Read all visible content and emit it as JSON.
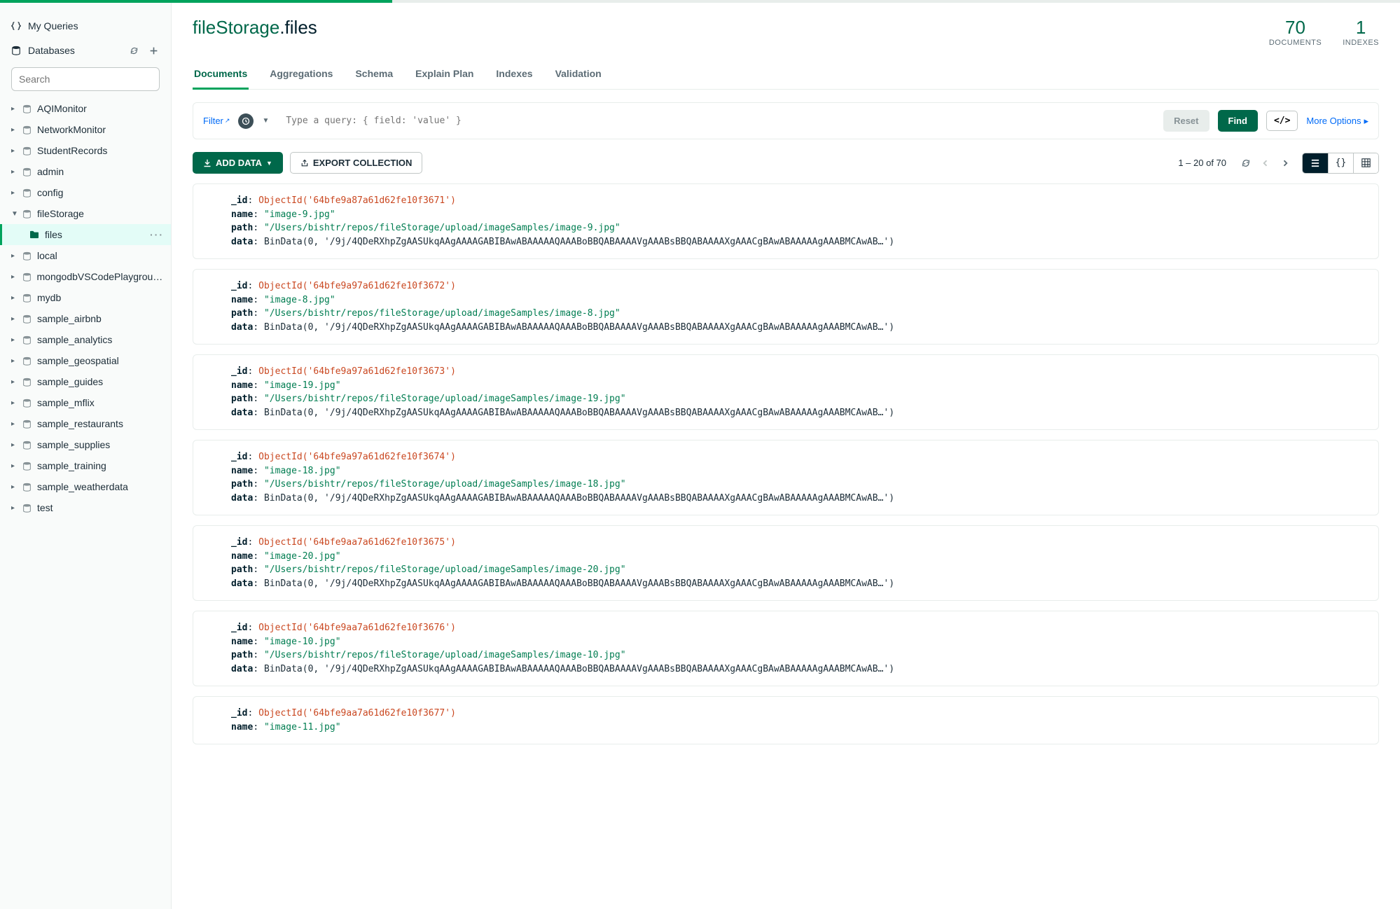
{
  "sidebar": {
    "my_queries": "My Queries",
    "databases_label": "Databases",
    "search_placeholder": "Search",
    "databases": [
      {
        "name": "AQIMonitor"
      },
      {
        "name": "NetworkMonitor"
      },
      {
        "name": "StudentRecords"
      },
      {
        "name": "admin"
      },
      {
        "name": "config"
      },
      {
        "name": "fileStorage",
        "expanded": true,
        "children": [
          {
            "name": "files",
            "selected": true
          }
        ]
      },
      {
        "name": "local"
      },
      {
        "name": "mongodbVSCodePlayground..."
      },
      {
        "name": "mydb"
      },
      {
        "name": "sample_airbnb"
      },
      {
        "name": "sample_analytics"
      },
      {
        "name": "sample_geospatial"
      },
      {
        "name": "sample_guides"
      },
      {
        "name": "sample_mflix"
      },
      {
        "name": "sample_restaurants"
      },
      {
        "name": "sample_supplies"
      },
      {
        "name": "sample_training"
      },
      {
        "name": "sample_weatherdata"
      },
      {
        "name": "test"
      }
    ]
  },
  "header": {
    "db_name": "fileStorage",
    "coll_name": ".files",
    "stats": [
      {
        "value": "70",
        "label": "DOCUMENTS"
      },
      {
        "value": "1",
        "label": "INDEXES"
      }
    ]
  },
  "tabs": [
    "Documents",
    "Aggregations",
    "Schema",
    "Explain Plan",
    "Indexes",
    "Validation"
  ],
  "filter": {
    "label": "Filter",
    "placeholder": "Type a query: { field: 'value' }",
    "reset": "Reset",
    "find": "Find",
    "code_toggle": "</>",
    "more_options": "More Options"
  },
  "toolbar": {
    "add_data": "ADD DATA",
    "export": "EXPORT COLLECTION",
    "page_info": "1 – 20 of 70",
    "json_view": "{}"
  },
  "documents": [
    {
      "id": "ObjectId('64bfe9a87a61d62fe10f3671')",
      "name": "\"image-9.jpg\"",
      "path": "\"/Users/bishtr/repos/fileStorage/upload/imageSamples/image-9.jpg\"",
      "data": "BinData(0, '/9j/4QDeRXhpZgAASUkqAAgAAAAGABIBAwABAAAAAQAAABoBBQABAAAAVgAAABsBBQABAAAAXgAAACgBAwABAAAAAgAAABMCAwAB…')"
    },
    {
      "id": "ObjectId('64bfe9a97a61d62fe10f3672')",
      "name": "\"image-8.jpg\"",
      "path": "\"/Users/bishtr/repos/fileStorage/upload/imageSamples/image-8.jpg\"",
      "data": "BinData(0, '/9j/4QDeRXhpZgAASUkqAAgAAAAGABIBAwABAAAAAQAAABoBBQABAAAAVgAAABsBBQABAAAAXgAAACgBAwABAAAAAgAAABMCAwAB…')"
    },
    {
      "id": "ObjectId('64bfe9a97a61d62fe10f3673')",
      "name": "\"image-19.jpg\"",
      "path": "\"/Users/bishtr/repos/fileStorage/upload/imageSamples/image-19.jpg\"",
      "data": "BinData(0, '/9j/4QDeRXhpZgAASUkqAAgAAAAGABIBAwABAAAAAQAAABoBBQABAAAAVgAAABsBBQABAAAAXgAAACgBAwABAAAAAgAAABMCAwAB…')"
    },
    {
      "id": "ObjectId('64bfe9a97a61d62fe10f3674')",
      "name": "\"image-18.jpg\"",
      "path": "\"/Users/bishtr/repos/fileStorage/upload/imageSamples/image-18.jpg\"",
      "data": "BinData(0, '/9j/4QDeRXhpZgAASUkqAAgAAAAGABIBAwABAAAAAQAAABoBBQABAAAAVgAAABsBBQABAAAAXgAAACgBAwABAAAAAgAAABMCAwAB…')"
    },
    {
      "id": "ObjectId('64bfe9aa7a61d62fe10f3675')",
      "name": "\"image-20.jpg\"",
      "path": "\"/Users/bishtr/repos/fileStorage/upload/imageSamples/image-20.jpg\"",
      "data": "BinData(0, '/9j/4QDeRXhpZgAASUkqAAgAAAAGABIBAwABAAAAAQAAABoBBQABAAAAVgAAABsBBQABAAAAXgAAACgBAwABAAAAAgAAABMCAwAB…')"
    },
    {
      "id": "ObjectId('64bfe9aa7a61d62fe10f3676')",
      "name": "\"image-10.jpg\"",
      "path": "\"/Users/bishtr/repos/fileStorage/upload/imageSamples/image-10.jpg\"",
      "data": "BinData(0, '/9j/4QDeRXhpZgAASUkqAAgAAAAGABIBAwABAAAAAQAAABoBBQABAAAAVgAAABsBBQABAAAAXgAAACgBAwABAAAAAgAAABMCAwAB…')"
    },
    {
      "id": "ObjectId('64bfe9aa7a61d62fe10f3677')",
      "name": "\"image-11.jpg\"",
      "path": "",
      "data": ""
    }
  ],
  "doc_keys": {
    "id": "_id",
    "name": "name",
    "path": "path",
    "data": "data"
  }
}
